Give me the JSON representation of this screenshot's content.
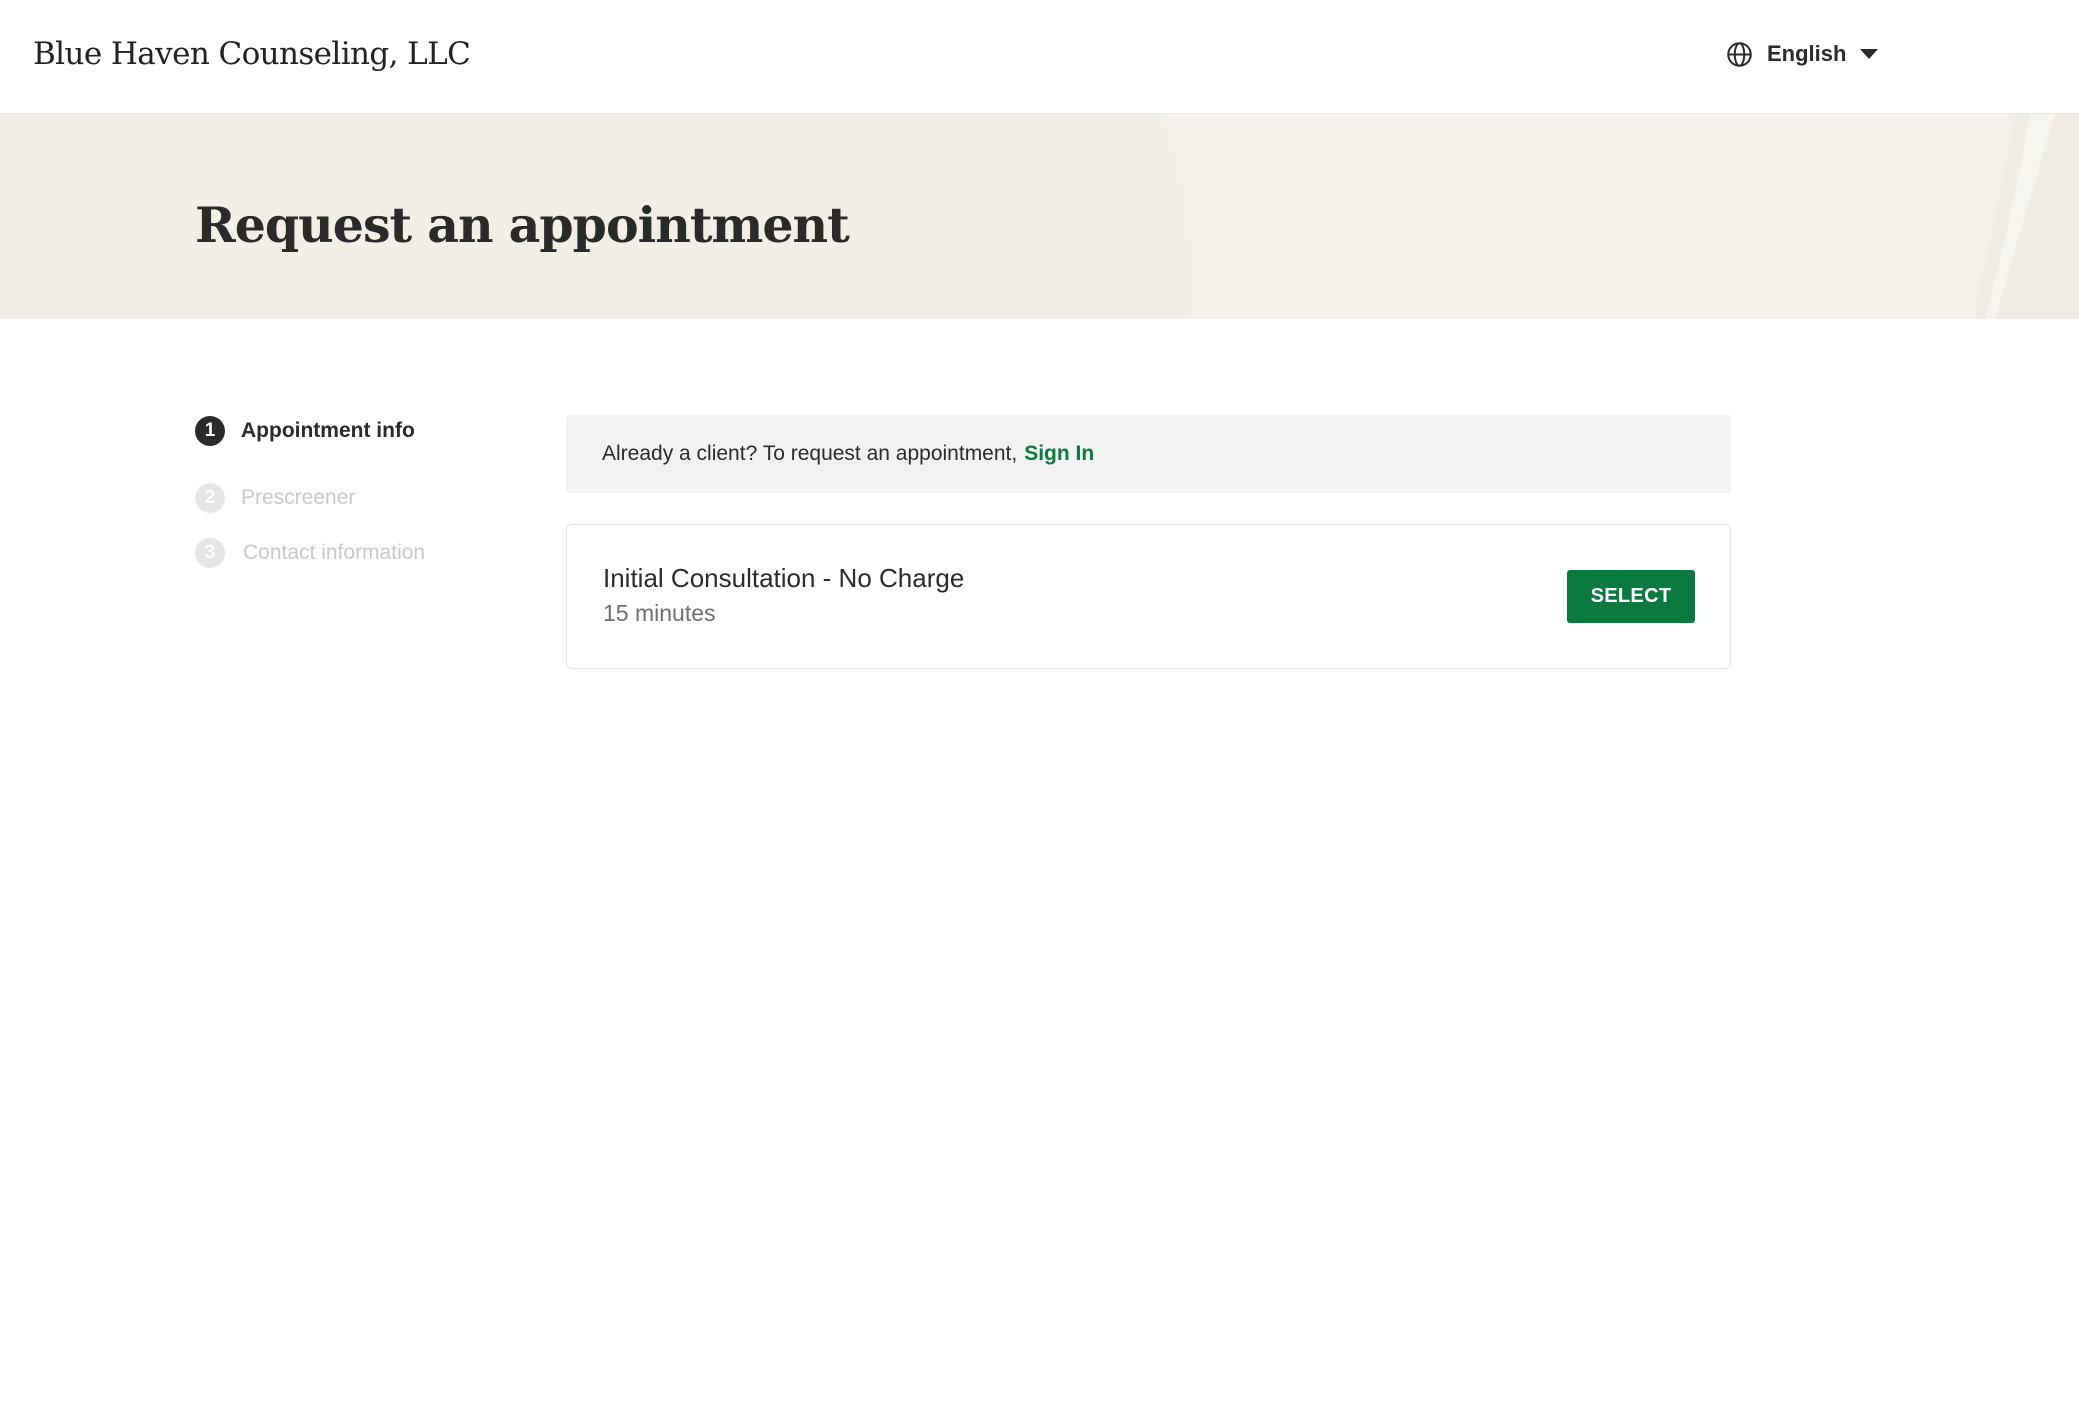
{
  "header": {
    "brand": "Blue Haven Counseling, LLC",
    "language": {
      "icon": "globe-icon",
      "selected": "English",
      "dropdown_icon": "caret-down-icon"
    }
  },
  "hero": {
    "title": "Request an appointment",
    "background_color": "#f3efe7"
  },
  "steps": [
    {
      "number": "1",
      "label": "Appointment info",
      "state": "active"
    },
    {
      "number": "2",
      "label": "Prescreener",
      "state": "inactive"
    },
    {
      "number": "3",
      "label": "Contact information",
      "state": "inactive"
    }
  ],
  "signin_banner": {
    "text": "Already a client? To request an appointment,",
    "link_label": "Sign In"
  },
  "services": [
    {
      "name": "Initial Consultation - No Charge",
      "duration": "15 minutes",
      "button_label": "SELECT"
    }
  ],
  "colors": {
    "accent": "#0b7a3f",
    "text": "#2b2b2b",
    "muted": "#6f6f6f",
    "banner_bg": "#f2f2f2"
  }
}
